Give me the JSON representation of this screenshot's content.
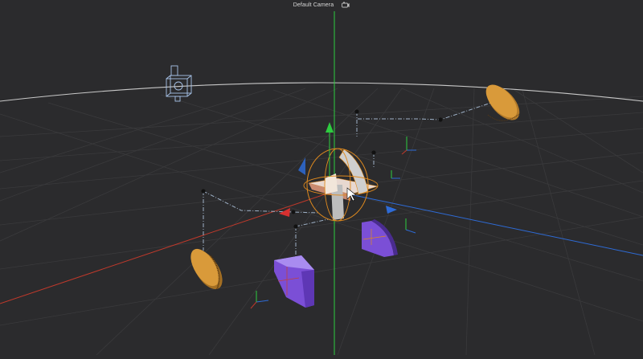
{
  "viewport": {
    "camera_label": "Default Camera",
    "camera_menu_icon": "camera-options-icon",
    "colors": {
      "background": "#2b2b2d",
      "grid": "#3a3a3c",
      "horizon": "#c8c8c8",
      "axis_x": "#c0392b",
      "axis_y": "#2ecc40",
      "axis_z": "#2e6bd6",
      "selection": "#e08a1e",
      "gold_material": "#d99a3a",
      "purple_material": "#7b4fd6",
      "link_line": "#9fb2c8"
    },
    "objects": [
      "camera-gizmo-icon",
      "gold-disc-top-right",
      "gold-disc-bottom-left",
      "purple-block-front",
      "purple-wedge-right",
      "selected-center-object",
      "transform-gizmo",
      "mouse-cursor-icon"
    ]
  }
}
